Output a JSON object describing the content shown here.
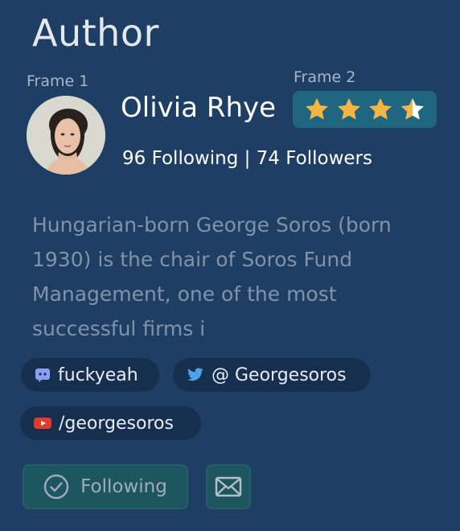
{
  "section": {
    "title": "Author"
  },
  "frames": {
    "frame1_label": "Frame 1",
    "frame2_label": "Frame 2"
  },
  "author": {
    "name": "Olivia Rhye",
    "stats": "96 Following | 74 Followers",
    "bio": "Hungarian-born George Soros (born 1930) is the chair of Soros Fund Management, one of the most successful firms i",
    "avatar_alt": "Olivia Rhye avatar"
  },
  "rating": {
    "value": 3.5,
    "max": 4,
    "star_color": "#f6b443",
    "empty_color": "#ffffff"
  },
  "socials": [
    {
      "icon": "discord-icon",
      "label": "fuckyeah"
    },
    {
      "icon": "twitter-icon",
      "label": "@ Georgesoros"
    },
    {
      "icon": "youtube-icon",
      "label": "/georgesoros"
    }
  ],
  "actions": {
    "follow_label": "Following",
    "follow_icon": "check-circle-icon",
    "mail_icon": "mail-icon"
  },
  "colors": {
    "background": "#1f3e63",
    "accent": "#206681",
    "chip_bg": "#172f4f"
  }
}
